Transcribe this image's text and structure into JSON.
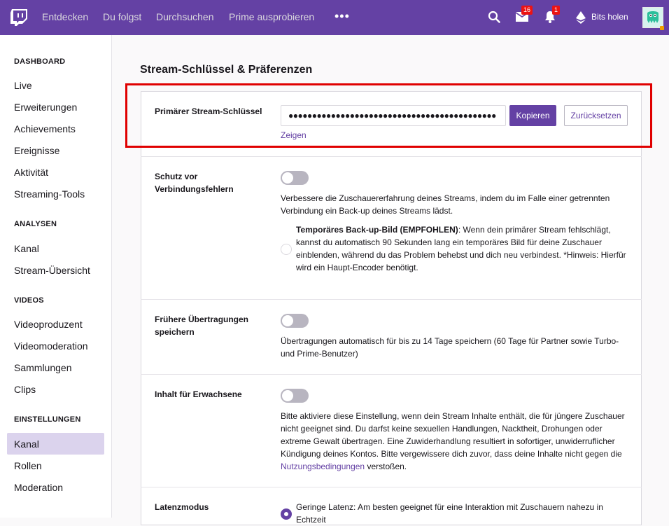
{
  "topnav": {
    "links": [
      "Entdecken",
      "Du folgst",
      "Durchsuchen",
      "Prime ausprobieren"
    ],
    "more": "•••",
    "inbox_badge": "16",
    "notifications_badge": "1",
    "bits_label": "Bits holen",
    "accent": "#6441a4"
  },
  "sidebar": {
    "sections": [
      {
        "heading": "DASHBOARD",
        "items": [
          "Live",
          "Erweiterungen",
          "Achievements",
          "Ereignisse",
          "Aktivität",
          "Streaming-Tools"
        ]
      },
      {
        "heading": "ANALYSEN",
        "items": [
          "Kanal",
          "Stream-Übersicht"
        ]
      },
      {
        "heading": "VIDEOS",
        "items": [
          "Videoproduzent",
          "Videomoderation",
          "Sammlungen",
          "Clips"
        ]
      },
      {
        "heading": "EINSTELLUNGEN",
        "items": [
          "Kanal",
          "Rollen",
          "Moderation"
        ]
      }
    ],
    "active_item": "Kanal"
  },
  "main": {
    "title": "Stream-Schlüssel & Präferenzen",
    "stream_key": {
      "label": "Primärer Stream-Schlüssel",
      "masked_value": "●●●●●●●●●●●●●●●●●●●●●●●●●●●●●●●●●●●●●●●●●●●●",
      "copy_label": "Kopieren",
      "reset_label": "Zurücksetzen",
      "show_label": "Zeigen"
    },
    "disconnect_protection": {
      "label": "Schutz vor Verbindungsfehlern",
      "enabled": false,
      "description": "Verbessere die Zuschauererfahrung deines Streams, indem du im Falle einer getrennten Verbindung ein Back-up deines Streams lädst.",
      "option_title": "Temporäres Back-up-Bild (EMPFOHLEN)",
      "option_text": ": Wenn dein primärer Stream fehlschlägt, kannst du automatisch 90 Sekunden lang ein temporäres Bild für deine Zuschauer einblenden, während du das Problem behebst und dich neu verbindest. *Hinweis: Hierfür wird ein Haupt-Encoder benötigt."
    },
    "store_past": {
      "label": "Frühere Übertragungen speichern",
      "enabled": false,
      "description": "Übertragungen automatisch für bis zu 14 Tage speichern (60 Tage für Partner sowie Turbo- und Prime-Benutzer)"
    },
    "mature": {
      "label": "Inhalt für Erwachsene",
      "enabled": false,
      "description_before": "Bitte aktiviere diese Einstellung, wenn dein Stream Inhalte enthält, die für jüngere Zuschauer nicht geeignet sind. Du darfst keine sexuellen Handlungen, Nacktheit, Drohungen oder extreme Gewalt übertragen. Eine Zuwiderhandlung resultiert in sofortiger, unwiderruflicher Kündigung deines Kontos. Bitte vergewissere dich zuvor, dass deine Inhalte nicht gegen die ",
      "link_text": "Nutzungsbedingungen",
      "description_after": " verstoßen."
    },
    "latency": {
      "label": "Latenzmodus",
      "option_text": "Geringe Latenz: Am besten geeignet für eine Interaktion mit Zuschauern nahezu in Echtzeit"
    }
  }
}
